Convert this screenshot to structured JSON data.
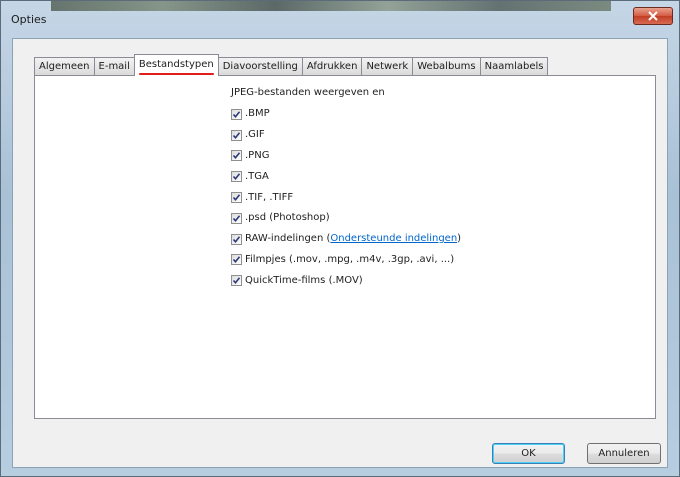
{
  "window": {
    "title": "Opties"
  },
  "tabs": [
    {
      "label": "Algemeen"
    },
    {
      "label": "E-mail"
    },
    {
      "label": "Bestandstypen",
      "active": true
    },
    {
      "label": "Diavoorstelling"
    },
    {
      "label": "Afdrukken"
    },
    {
      "label": "Netwerk"
    },
    {
      "label": "Webalbums"
    },
    {
      "label": "Naamlabels"
    }
  ],
  "panel": {
    "heading": "JPEG-bestanden weergeven en",
    "options": [
      {
        "label": ".BMP",
        "checked": true
      },
      {
        "label": ".GIF",
        "checked": true
      },
      {
        "label": ".PNG",
        "checked": true
      },
      {
        "label": ".TGA",
        "checked": true
      },
      {
        "label": ".TIF, .TIFF",
        "checked": true
      },
      {
        "label": ".psd (Photoshop)",
        "checked": true
      },
      {
        "label": "RAW-indelingen (",
        "link": "Ondersteunde indelingen",
        "suffix": ")",
        "checked": true
      },
      {
        "label": "Filmpjes (.mov, .mpg, .m4v, .3gp, .avi, ...)",
        "checked": true
      },
      {
        "label": "QuickTime-films (.MOV)",
        "checked": true
      }
    ]
  },
  "buttons": {
    "ok": "OK",
    "cancel": "Annuleren"
  },
  "colors": {
    "active_tab_underline": "#e21b1b",
    "link": "#0066cc",
    "close_button": "#c13d25"
  }
}
